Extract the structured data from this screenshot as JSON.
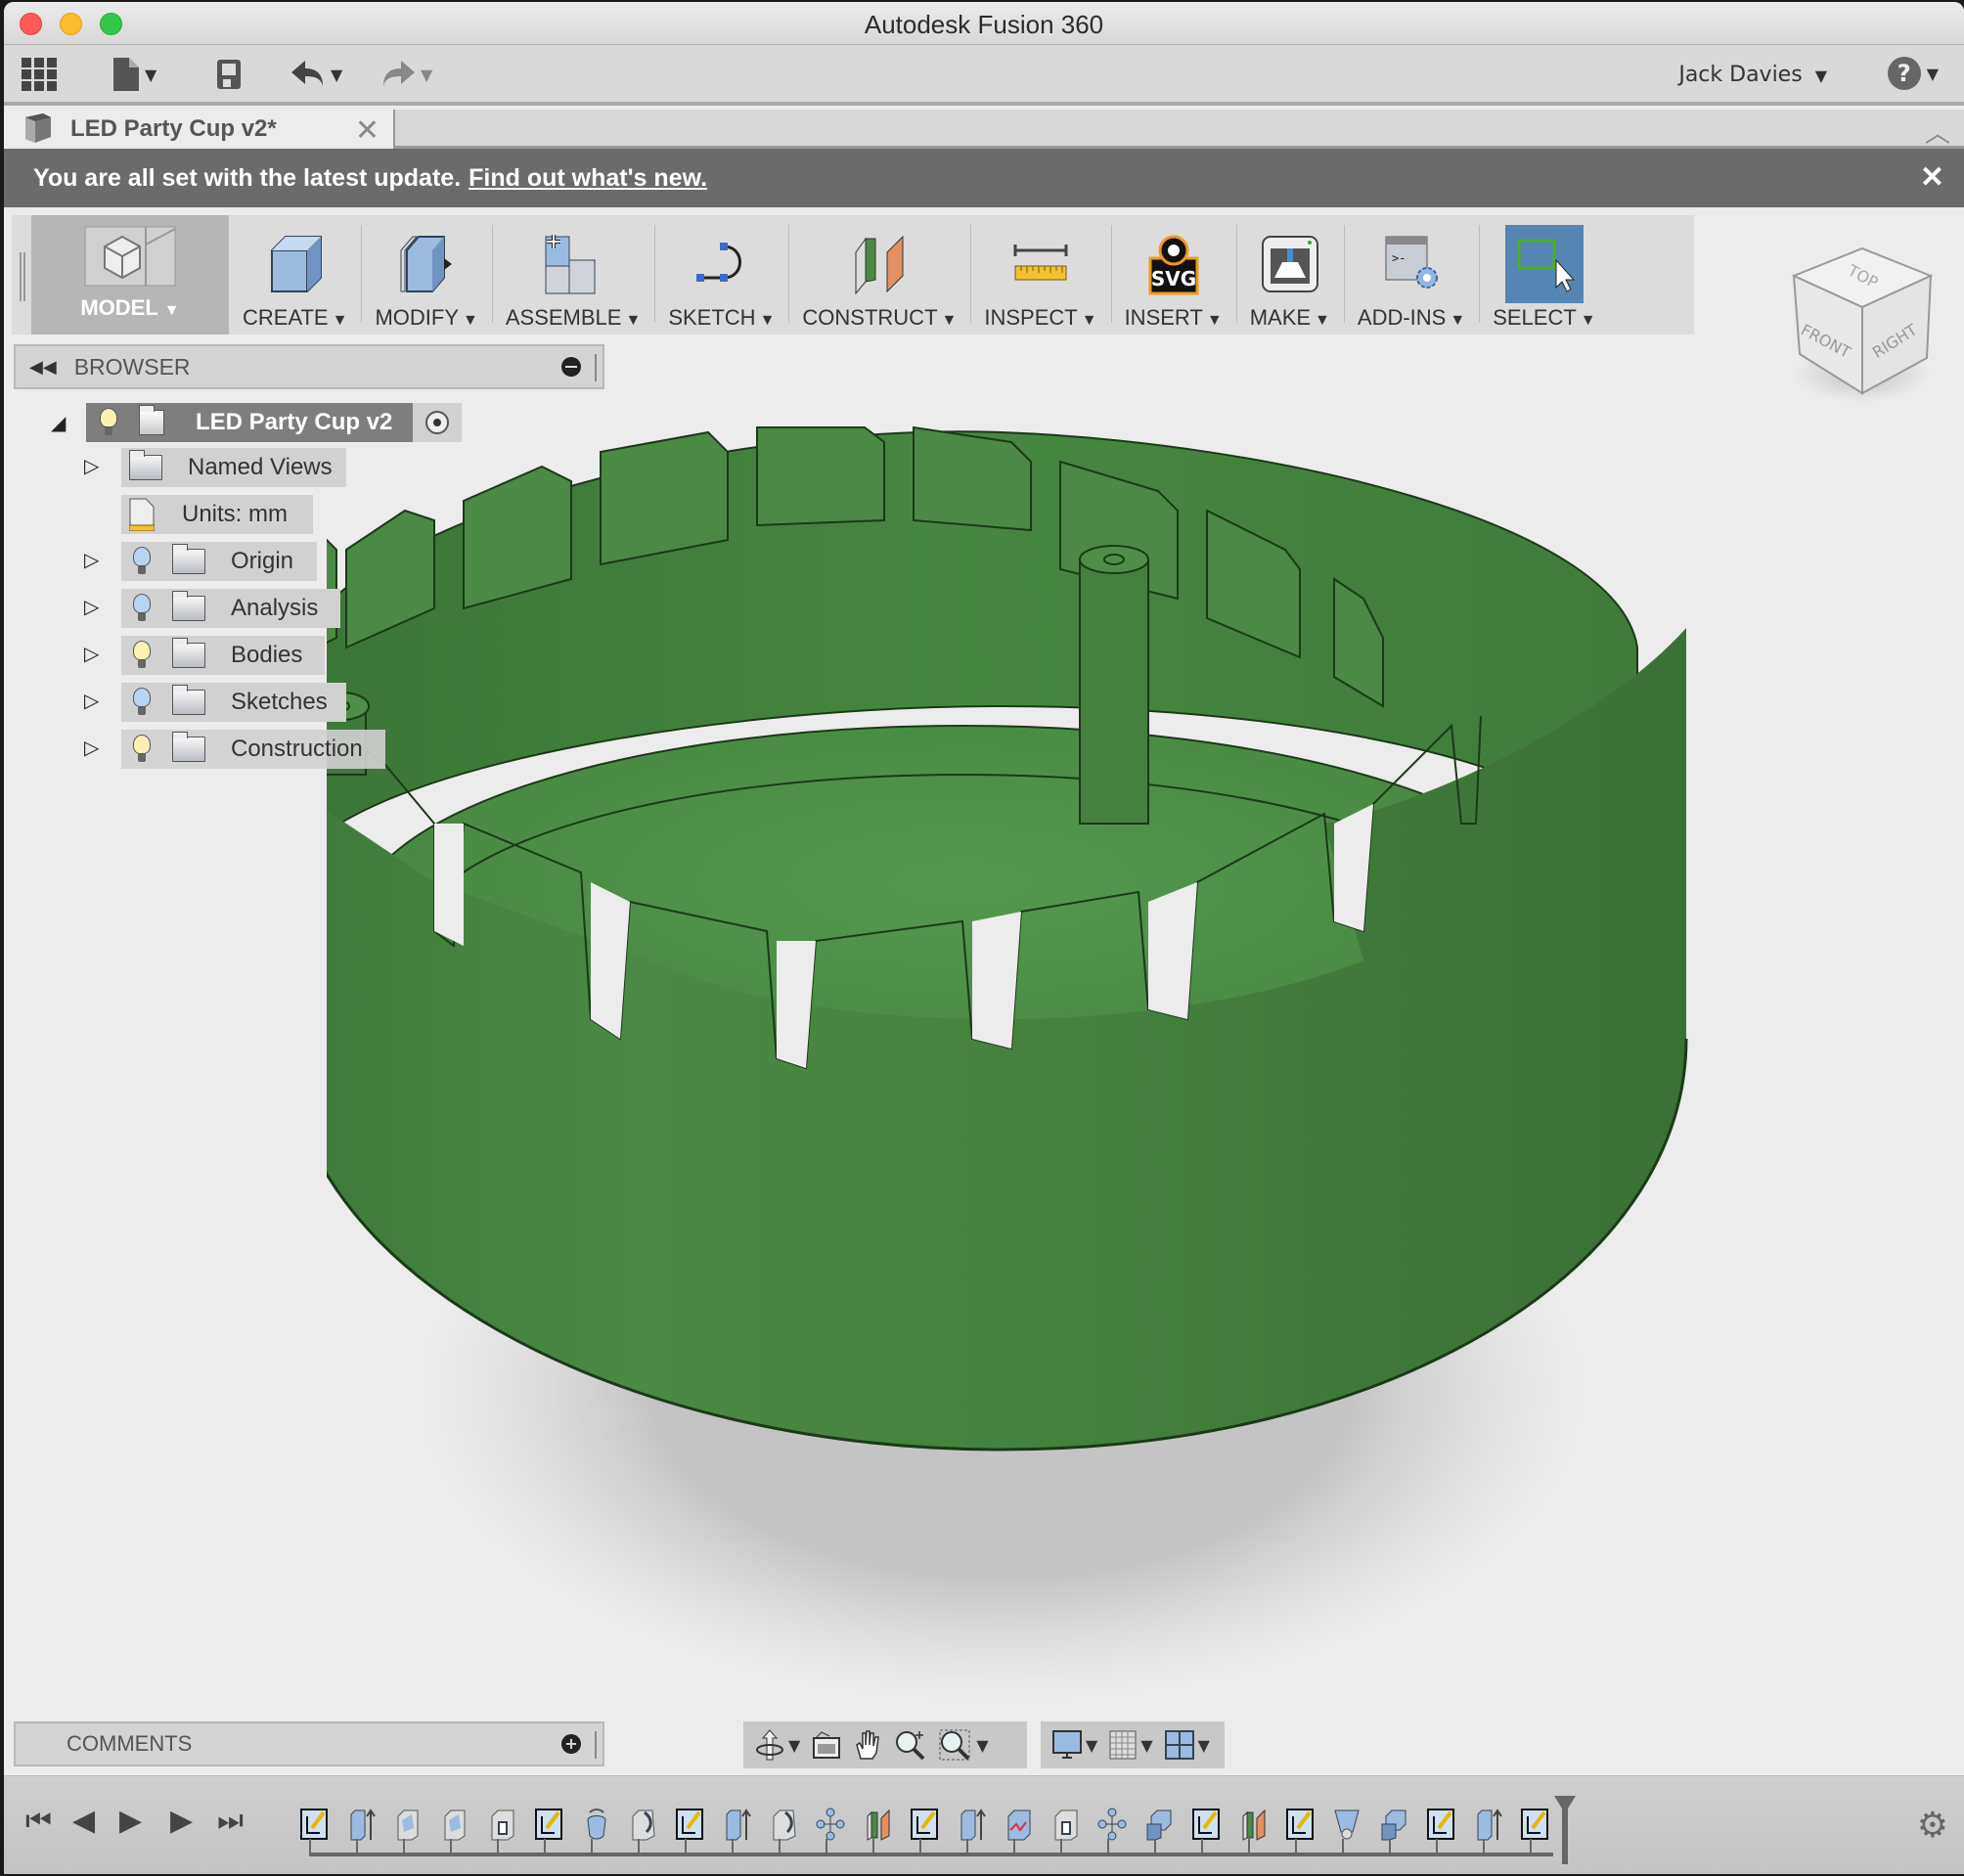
{
  "window": {
    "title": "Autodesk Fusion 360"
  },
  "quick_access": {
    "user_name": "Jack Davies",
    "help_label": "?"
  },
  "document_tab": {
    "label": "LED Party Cup v2*",
    "close": "✕",
    "collapse": "︿"
  },
  "notification": {
    "message": "You are all set with the latest update.",
    "link": "Find out what's new.",
    "close": "✕"
  },
  "ribbon": {
    "workspace": "MODEL",
    "groups": [
      {
        "label": "CREATE",
        "icon": "box-icon"
      },
      {
        "label": "MODIFY",
        "icon": "press-pull-icon"
      },
      {
        "label": "ASSEMBLE",
        "icon": "new-component-icon"
      },
      {
        "label": "SKETCH",
        "icon": "sketch-curve-icon"
      },
      {
        "label": "CONSTRUCT",
        "icon": "plane-icon"
      },
      {
        "label": "INSPECT",
        "icon": "measure-icon"
      },
      {
        "label": "INSERT",
        "icon": "svg-icon"
      },
      {
        "label": "MAKE",
        "icon": "3d-print-icon"
      },
      {
        "label": "ADD-INS",
        "icon": "scripts-icon"
      },
      {
        "label": "SELECT",
        "icon": "select-icon",
        "active": true
      }
    ]
  },
  "viewcube": {
    "top": "TOP",
    "front": "FRONT",
    "right": "RIGHT"
  },
  "browser": {
    "title": "BROWSER",
    "root": {
      "label": "LED Party Cup v2",
      "expanded": true
    },
    "items": [
      {
        "label": "Named Views",
        "has_bulb": false,
        "bulb_on": false,
        "icon": "folder-icon"
      },
      {
        "label": "Units: mm",
        "has_bulb": false,
        "bulb_on": false,
        "icon": "document-units-icon",
        "no_expander": true
      },
      {
        "label": "Origin",
        "has_bulb": true,
        "bulb_on": false,
        "icon": "folder-icon"
      },
      {
        "label": "Analysis",
        "has_bulb": true,
        "bulb_on": false,
        "icon": "folder-icon"
      },
      {
        "label": "Bodies",
        "has_bulb": true,
        "bulb_on": true,
        "icon": "folder-icon"
      },
      {
        "label": "Sketches",
        "has_bulb": true,
        "bulb_on": false,
        "icon": "folder-icon"
      },
      {
        "label": "Construction",
        "has_bulb": true,
        "bulb_on": true,
        "icon": "folder-icon"
      }
    ]
  },
  "comments": {
    "title": "COMMENTS"
  },
  "navigation_bar": {
    "tools": [
      "orbit",
      "look-at",
      "pan",
      "zoom",
      "zoom-window"
    ],
    "display": [
      "display-settings",
      "grid-snaps",
      "viewports"
    ]
  },
  "timeline": {
    "controls": [
      "go-to-start",
      "previous-step",
      "play",
      "next-step",
      "go-to-end"
    ],
    "features": [
      "sketch",
      "extrude",
      "shell",
      "shell",
      "hole",
      "sketch",
      "revolve",
      "fillet",
      "sketch",
      "extrude",
      "fillet",
      "pattern",
      "offset-plane",
      "sketch",
      "extrude",
      "split-body",
      "hole",
      "pattern",
      "combine",
      "sketch",
      "offset-plane",
      "sketch",
      "chamfer",
      "combine",
      "sketch",
      "extrude",
      "sketch"
    ]
  },
  "colors": {
    "model_green": "#4a8a44",
    "select_blue": "#5585b3",
    "notification_bg": "#6b6b6b"
  }
}
